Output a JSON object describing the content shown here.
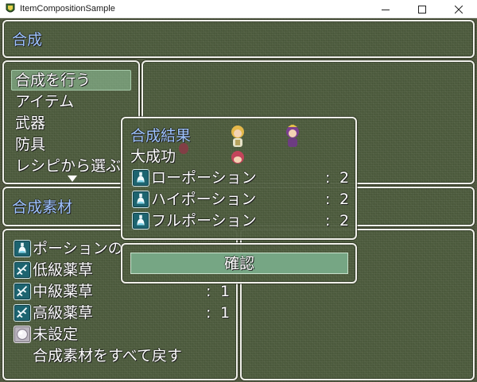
{
  "window": {
    "title": "ItemCompositionSample",
    "app_icon": "app-icon",
    "controls": [
      "minimize-icon",
      "maximize-icon",
      "close-icon"
    ]
  },
  "header": {
    "title": "合成"
  },
  "command_menu": {
    "items": [
      {
        "label": "合成を行う",
        "selected": true
      },
      {
        "label": "アイテム",
        "selected": false
      },
      {
        "label": "武器",
        "selected": false
      },
      {
        "label": "防具",
        "selected": false
      },
      {
        "label": "レシピから選ぶ",
        "selected": false
      }
    ],
    "scroll_arrow": "triangle-down-icon"
  },
  "materials_header": {
    "title": "合成素材"
  },
  "material_list": {
    "items": [
      {
        "icon": "potion-icon",
        "name": "ポーションの",
        "separator": "",
        "quantity": ""
      },
      {
        "icon": "herb-icon",
        "name": "低級薬草",
        "separator": "",
        "quantity": ""
      },
      {
        "icon": "herb-icon",
        "name": "中級薬草",
        "separator": ":",
        "quantity": "1"
      },
      {
        "icon": "herb-icon",
        "name": "高級薬草",
        "separator": ":",
        "quantity": "1"
      },
      {
        "icon": "empty-orb-icon",
        "name": "未設定",
        "separator": "",
        "quantity": ""
      }
    ],
    "return_all_label": "合成素材をすべて戻す"
  },
  "result_dialog": {
    "title": "合成結果",
    "outcome": "大成功",
    "items": [
      {
        "icon": "potion-icon",
        "name": "ローポーション",
        "separator": ":",
        "quantity": "2"
      },
      {
        "icon": "potion-icon",
        "name": "ハイポーション",
        "separator": ":",
        "quantity": "2"
      },
      {
        "icon": "potion-icon",
        "name": "フルポーション",
        "separator": ":",
        "quantity": "2"
      }
    ]
  },
  "confirm_dialog": {
    "button_label": "確認"
  },
  "colors": {
    "window_bg": "#4e5d3e",
    "system_text": "#9ec3ff",
    "normal_text": "#ffffff",
    "selection": "#8fc39b",
    "confirm_button": "#76a684",
    "icon_bg": "#1d6470"
  }
}
